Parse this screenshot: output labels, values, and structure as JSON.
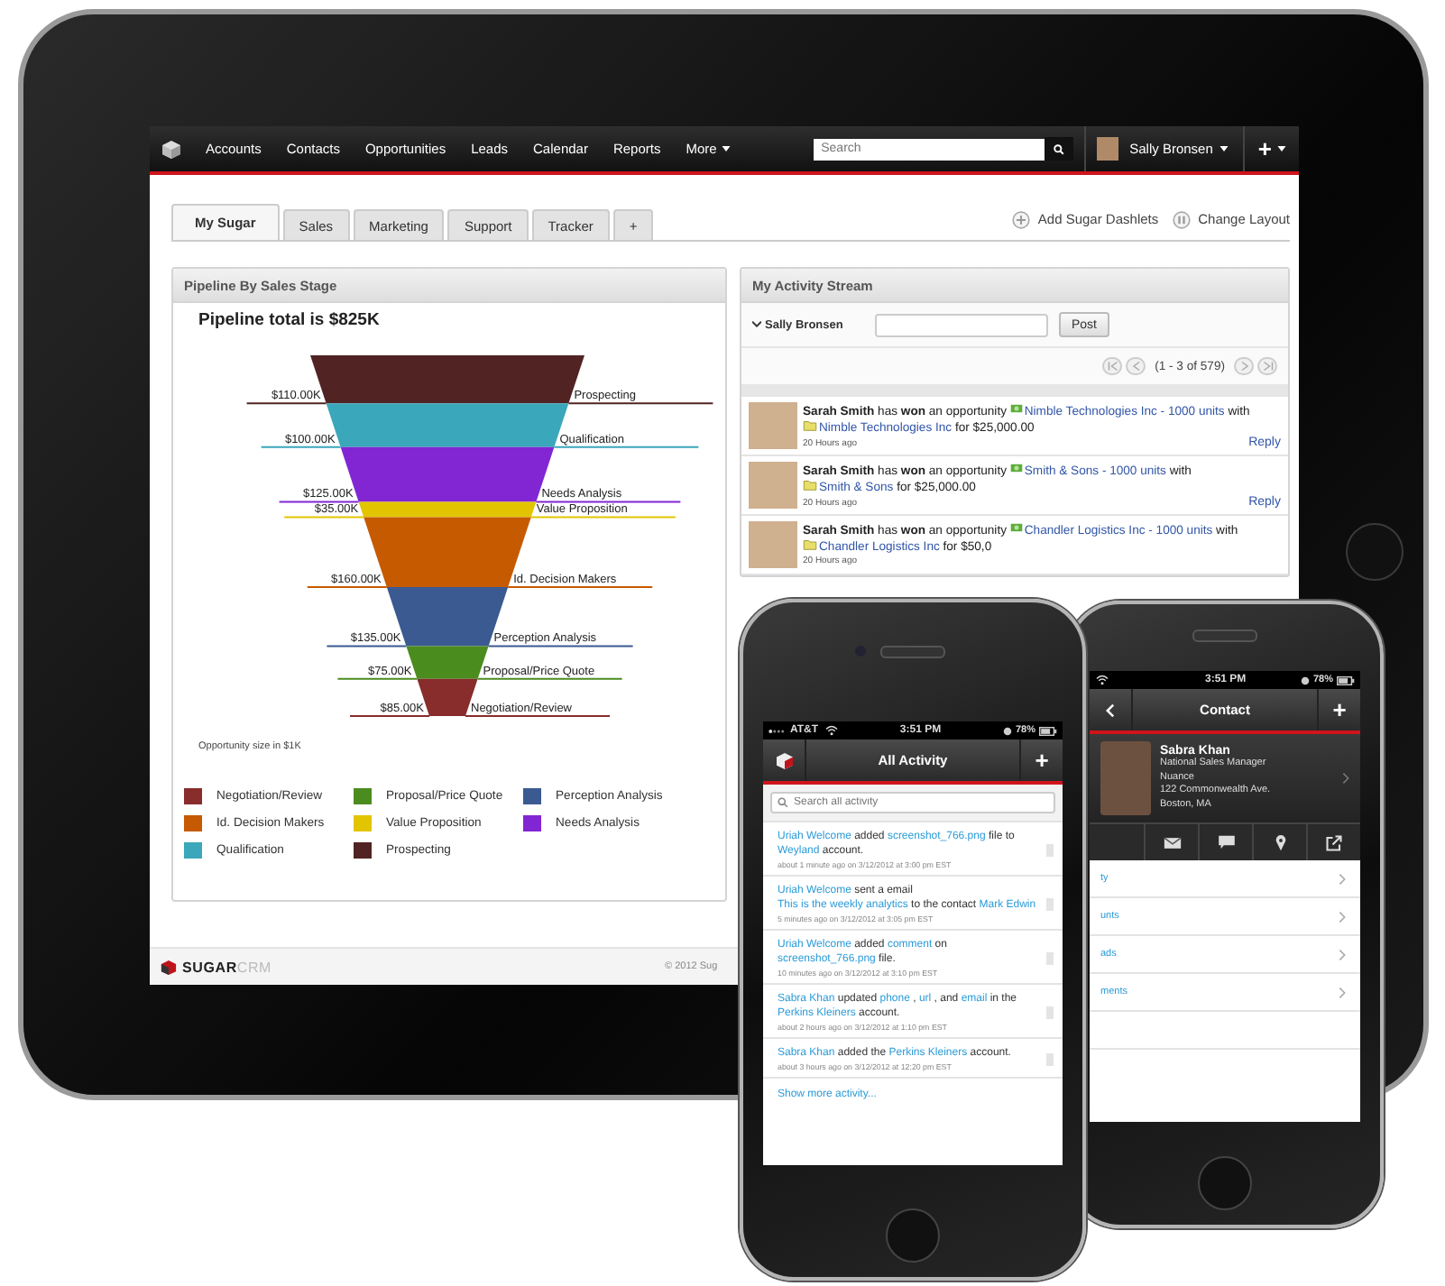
{
  "ipad": {
    "nav": {
      "items": [
        "Accounts",
        "Contacts",
        "Opportunities",
        "Leads",
        "Calendar",
        "Reports"
      ],
      "more": "More",
      "search": {
        "placeholder": "Search"
      },
      "user": "Sally Bronsen",
      "add": "+"
    },
    "tabs": [
      {
        "label": "My Sugar",
        "selected": true
      },
      {
        "label": "Sales",
        "selected": false
      },
      {
        "label": "Marketing",
        "selected": false
      },
      {
        "label": "Support",
        "selected": false
      },
      {
        "label": "Tracker",
        "selected": false
      },
      {
        "label": "+",
        "selected": false
      }
    ],
    "actions": [
      {
        "kind": "add",
        "label": "Add Sugar Dashlets"
      },
      {
        "kind": "layout",
        "label": "Change Layout"
      }
    ],
    "pipeline": {
      "title": "Pipeline By Sales Stage",
      "total": "Pipeline total is $825K",
      "stages": [
        {
          "name": "Prospecting",
          "amount": "$110.00K",
          "color": "#512323"
        },
        {
          "name": "Qualification",
          "amount": "$100.00K",
          "color": "#3ba7ba"
        },
        {
          "name": "Needs Analysis",
          "amount": "$125.00K",
          "color": "#8226d4"
        },
        {
          "name": "Value Proposition",
          "amount": "$35.00K",
          "color": "#e2c500"
        },
        {
          "name": "Id. Decision Makers",
          "amount": "$160.00K",
          "color": "#c65a00"
        },
        {
          "name": "Perception Analysis",
          "amount": "$135.00K",
          "color": "#3a5a91"
        },
        {
          "name": "Proposal/Price Quote",
          "amount": "$75.00K",
          "color": "#4b8c1e"
        },
        {
          "name": "Negotiation/Review",
          "amount": "$85.00K",
          "color": "#882c2c"
        }
      ],
      "note": "Opportunity size in $1K",
      "legend": [
        {
          "label": "Negotiation/Review",
          "color": "#882c2c"
        },
        {
          "label": "Proposal/Price Quote",
          "color": "#4b8c1e"
        },
        {
          "label": "Perception Analysis",
          "color": "#3a5a91"
        },
        {
          "label": "Id. Decision Makers",
          "color": "#c65a00"
        },
        {
          "label": "Value Proposition",
          "color": "#e2c500"
        },
        {
          "label": "Needs Analysis",
          "color": "#8226d4"
        },
        {
          "label": "Qualification",
          "color": "#3ba7ba"
        },
        {
          "label": "Prospecting",
          "color": "#512323"
        }
      ]
    },
    "activity": {
      "title": "My Activity Stream",
      "user": "Sally Bronsen",
      "post": "Post",
      "pager": "(1 - 3 of 579)",
      "items": [
        {
          "parts": [
            {
              "kind": "text",
              "text": "**Sarah Smith** has **won** an opportunity"
            },
            {
              "kind": "opportunity",
              "text": "Nimble Technologies Inc - 1000 units"
            },
            {
              "kind": "text",
              "text": "with"
            },
            {
              "kind": "account",
              "text": "Nimble Technologies Inc"
            },
            {
              "kind": "text",
              "text": "for $25,000.00"
            }
          ],
          "time": "20 Hours ago",
          "reply": "Reply"
        },
        {
          "parts": [
            {
              "kind": "text",
              "text": "**Sarah Smith** has **won** an opportunity"
            },
            {
              "kind": "opportunity",
              "text": "Smith & Sons - 1000 units"
            },
            {
              "kind": "text",
              "text": "with"
            },
            {
              "kind": "account",
              "text": "Smith & Sons"
            },
            {
              "kind": "text",
              "text": "for $25,000.00"
            }
          ],
          "time": "20 Hours ago",
          "reply": "Reply"
        },
        {
          "parts": [
            {
              "kind": "text",
              "text": "**Sarah Smith** has **won** an opportunity"
            },
            {
              "kind": "opportunity",
              "text": "Chandler Logistics Inc - 1000 units"
            },
            {
              "kind": "text",
              "text": "with"
            },
            {
              "kind": "account",
              "text": "Chandler Logistics Inc"
            },
            {
              "kind": "text",
              "text": "for $50,0"
            }
          ],
          "time": "20 Hours ago"
        }
      ]
    },
    "footer": {
      "logo_bold": "SUGAR",
      "logo_light": "CRM",
      "copyright": "© 2012 Sug"
    }
  },
  "phone_activity": {
    "status": {
      "carrier": "AT&T",
      "time": "3:51 PM",
      "battery": "78%"
    },
    "title": "All Activity",
    "add": "+",
    "search": {
      "placeholder": "Search all activity"
    },
    "items": [
      {
        "parts": [
          {
            "kind": "link",
            "text": "Uriah Welcome"
          },
          {
            "kind": "text",
            "text": "added"
          },
          {
            "kind": "link",
            "text": "screenshot_766.png"
          },
          {
            "kind": "text",
            "text": "file to"
          },
          {
            "kind": "link",
            "text": "Weyland"
          },
          {
            "kind": "text",
            "text": "account."
          }
        ],
        "meta": "about 1 minute ago on 3/12/2012 at 3:00 pm EST"
      },
      {
        "parts": [
          {
            "kind": "link",
            "text": "Uriah Welcome"
          },
          {
            "kind": "text",
            "text": "sent a email"
          },
          {
            "kind": "link",
            "text": "This is the weekly analytics"
          },
          {
            "kind": "text",
            "text": "to the contact"
          },
          {
            "kind": "link",
            "text": "Mark Edwin"
          }
        ],
        "meta": "5 minutes ago on 3/12/2012 at 3:05 pm EST"
      },
      {
        "parts": [
          {
            "kind": "link",
            "text": "Uriah Welcome"
          },
          {
            "kind": "text",
            "text": "added"
          },
          {
            "kind": "link",
            "text": "comment"
          },
          {
            "kind": "text",
            "text": "on"
          },
          {
            "kind": "link",
            "text": "screenshot_766.png"
          },
          {
            "kind": "text",
            "text": "file."
          }
        ],
        "meta": "10 minutes ago on 3/12/2012 at 3:10 pm EST"
      },
      {
        "parts": [
          {
            "kind": "link",
            "text": "Sabra Khan"
          },
          {
            "kind": "text",
            "text": "updated"
          },
          {
            "kind": "link",
            "text": "phone"
          },
          {
            "kind": "text",
            "text": ","
          },
          {
            "kind": "link",
            "text": "url"
          },
          {
            "kind": "text",
            "text": ", and"
          },
          {
            "kind": "link",
            "text": "email"
          },
          {
            "kind": "text",
            "text": "in the"
          },
          {
            "kind": "link",
            "text": "Perkins Kleiners"
          },
          {
            "kind": "text",
            "text": "account."
          }
        ],
        "meta": "about 2 hours ago on 3/12/2012 at 1:10 pm EST"
      },
      {
        "parts": [
          {
            "kind": "link",
            "text": "Sabra Khan"
          },
          {
            "kind": "text",
            "text": "added the"
          },
          {
            "kind": "link",
            "text": "Perkins Kleiners"
          },
          {
            "kind": "text",
            "text": "account."
          }
        ],
        "meta": "about 3 hours ago on 3/12/2012 at 12:20 pm EST"
      }
    ],
    "more": "Show more activity..."
  },
  "phone_contact": {
    "status": {
      "time": "3:51 PM",
      "battery": "78%"
    },
    "title": "Contact",
    "add": "+",
    "name": "Sabra Khan",
    "lines": [
      "National Sales Manager",
      "Nuance",
      "122 Commonwealth Ave.",
      "Boston, MA"
    ],
    "links": [
      "ty",
      "unts",
      "ads",
      "ments"
    ]
  }
}
